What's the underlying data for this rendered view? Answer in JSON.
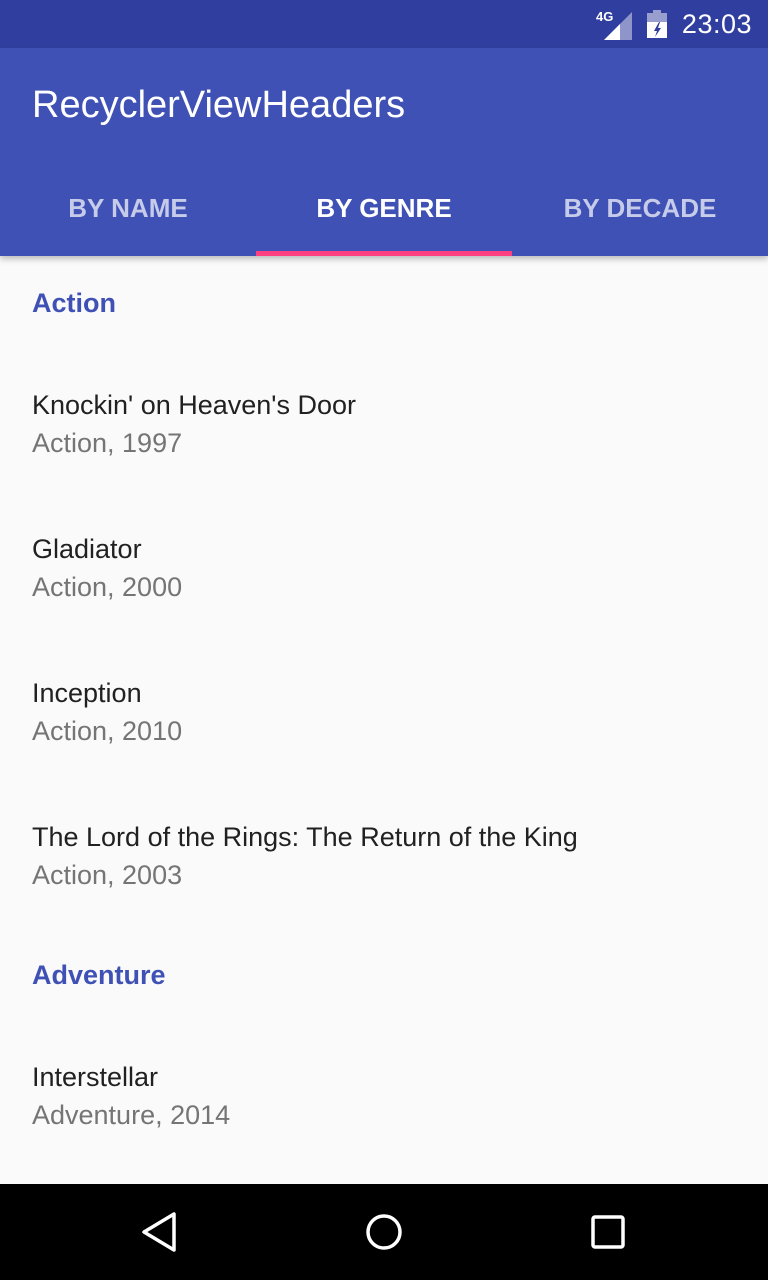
{
  "status_bar": {
    "network_type": "4G",
    "time": "23:03",
    "icons": [
      "signal-icon",
      "battery-icon"
    ]
  },
  "app_bar": {
    "title": "RecyclerViewHeaders",
    "tabs": [
      {
        "label": "BY NAME",
        "active": false
      },
      {
        "label": "BY GENRE",
        "active": true
      },
      {
        "label": "BY DECADE",
        "active": false
      }
    ]
  },
  "list": {
    "sections": [
      {
        "header": "Action",
        "items": [
          {
            "title": "Knockin' on Heaven's Door",
            "meta": "Action, 1997"
          },
          {
            "title": "Gladiator",
            "meta": "Action, 2000"
          },
          {
            "title": "Inception",
            "meta": "Action, 2010"
          },
          {
            "title": "The Lord of the Rings: The Return of the King",
            "meta": "Action, 2003"
          }
        ]
      },
      {
        "header": "Adventure",
        "items": [
          {
            "title": "Interstellar",
            "meta": "Adventure, 2014"
          }
        ]
      }
    ]
  },
  "nav_bar": {
    "icons": [
      "back-icon",
      "home-icon",
      "recents-icon"
    ]
  },
  "colors": {
    "status_bar": "#303f9f",
    "primary": "#3f51b5",
    "accent": "#ff4081",
    "background": "#fafafa",
    "primary_text": "#212121",
    "secondary_text": "#757575"
  }
}
